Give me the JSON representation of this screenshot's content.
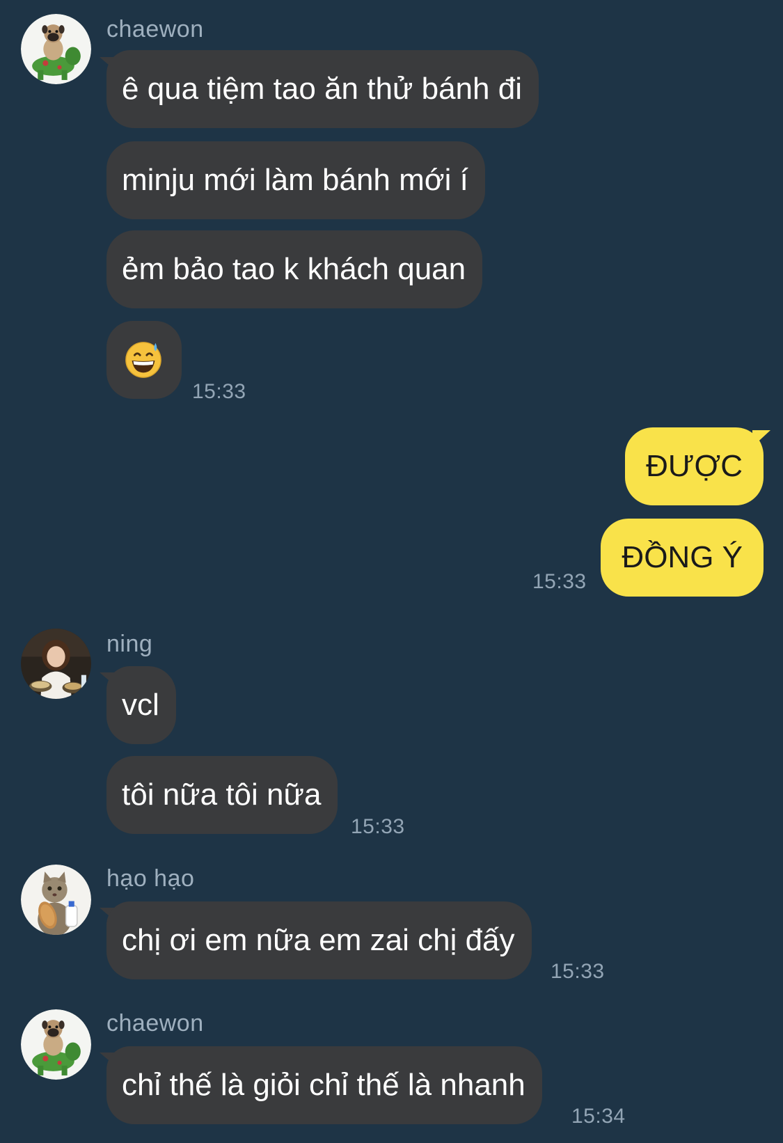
{
  "colors": {
    "background": "#1e3446",
    "incoming_bubble": "#3a3b3d",
    "outgoing_bubble": "#f9e24a",
    "sender_name": "#9fb0bf",
    "timestamp": "#93a5b5"
  },
  "groups": [
    {
      "sender": "chaewon",
      "avatar": "pug-riding-toy-horse-avatar",
      "messages": [
        "ê qua tiệm tao ăn thử bánh đi",
        "minju mới làm bánh mới í",
        "ẻm bảo tao k khách quan"
      ],
      "emoji": "grinning-face-with-sweat-emoji",
      "time": "15:33"
    },
    {
      "sender": "me",
      "messages": [
        "ĐƯỢC",
        "ĐỒNG Ý"
      ],
      "time": "15:33"
    },
    {
      "sender": "ning",
      "avatar": "girl-eating-noodles-avatar",
      "messages": [
        "vcl",
        "tôi nữa tôi nữa"
      ],
      "time": "15:33"
    },
    {
      "sender": "hạo hạo",
      "avatar": "cat-holding-bread-avatar",
      "messages": [
        "chị ơi em nữa em zai chị đấy"
      ],
      "time": "15:33"
    },
    {
      "sender": "chaewon",
      "avatar": "pug-riding-toy-horse-avatar",
      "messages": [
        "chỉ thế là giỏi chỉ thế là nhanh"
      ],
      "time": "15:34"
    }
  ]
}
